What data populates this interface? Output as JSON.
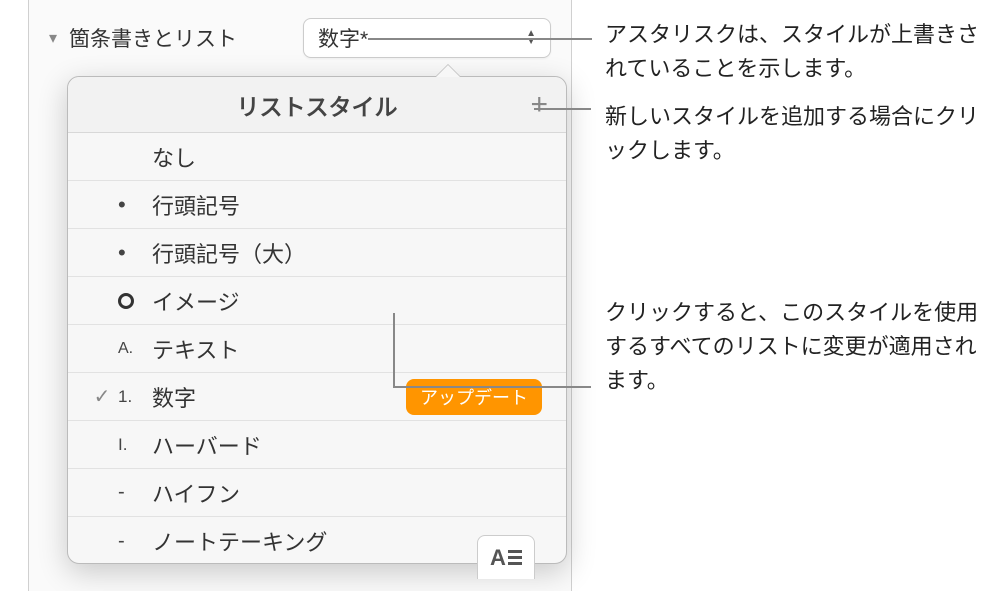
{
  "header": {
    "section_label": "箇条書きとリスト",
    "dropdown_value": "数字*"
  },
  "popover": {
    "title": "リストスタイル",
    "add_label": "+",
    "items": [
      {
        "check": "",
        "bullet": "",
        "label": "なし",
        "badge": ""
      },
      {
        "check": "",
        "bullet": "•",
        "label": "行頭記号",
        "badge": ""
      },
      {
        "check": "",
        "bullet": "•",
        "label": "行頭記号（大）",
        "badge": ""
      },
      {
        "check": "",
        "bullet": "circle",
        "label": "イメージ",
        "badge": ""
      },
      {
        "check": "",
        "bullet": "A.",
        "label": "テキスト",
        "badge": ""
      },
      {
        "check": "✓",
        "bullet": "1.",
        "label": "数字",
        "badge": "アップデート"
      },
      {
        "check": "",
        "bullet": "I.",
        "label": "ハーバード",
        "badge": ""
      },
      {
        "check": "",
        "bullet": "-",
        "label": "ハイフン",
        "badge": ""
      },
      {
        "check": "",
        "bullet": "-",
        "label": "ノートテーキング",
        "badge": ""
      }
    ]
  },
  "callouts": {
    "asterisk": "アスタリスクは、スタイルが上書きされていることを示します。",
    "add": "新しいスタイルを追加する場合にクリックします。",
    "update": "クリックすると、このスタイルを使用するすべてのリストに変更が適用されます。"
  }
}
